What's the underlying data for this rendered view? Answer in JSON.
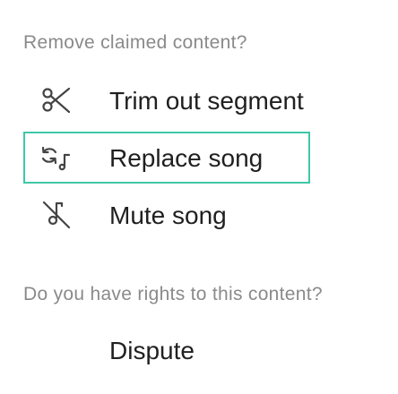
{
  "remove_section": {
    "heading": "Remove claimed content?",
    "options": [
      {
        "label": "Trim out segment",
        "icon": "scissors-icon",
        "focused": false
      },
      {
        "label": "Replace song",
        "icon": "swap-music-icon",
        "focused": true
      },
      {
        "label": "Mute song",
        "icon": "mute-song-icon",
        "focused": false
      }
    ]
  },
  "rights_section": {
    "heading": "Do you have rights to this content?",
    "dispute_label": "Dispute"
  },
  "colors": {
    "focus_border": "#3fc7a6",
    "heading_text": "#8a8a8a",
    "option_text": "#202020",
    "background": "#ffffff"
  }
}
